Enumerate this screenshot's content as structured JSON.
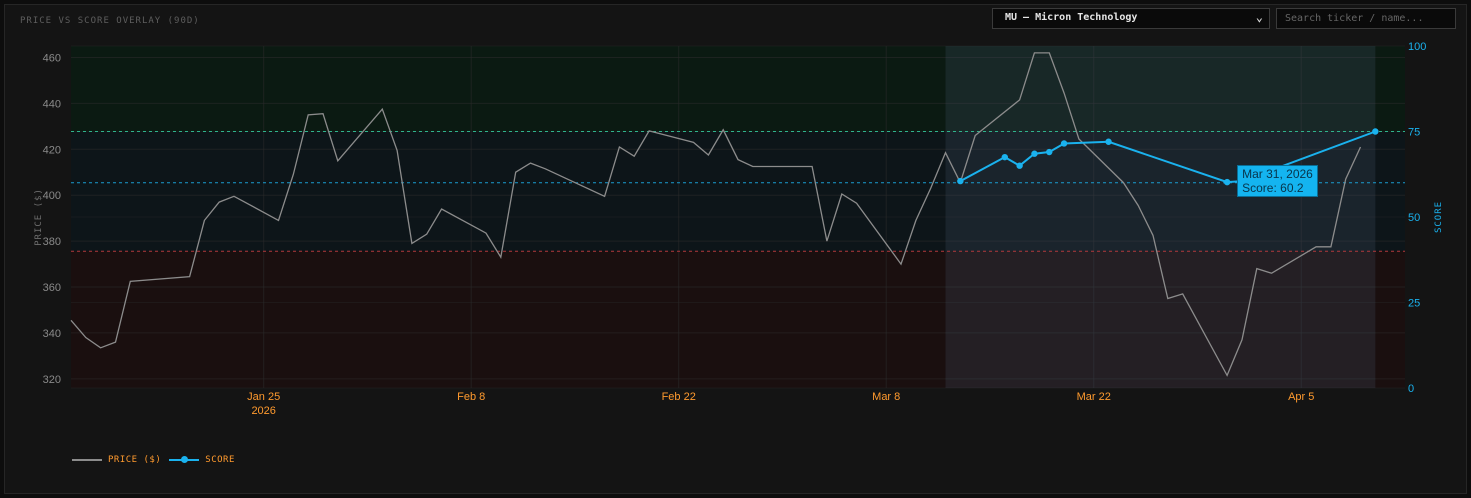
{
  "panel": {
    "title": "PRICE VS SCORE OVERLAY (90D)",
    "ticker_select_value": "MU — Micron Technology",
    "search_placeholder": "Search ticker / name..."
  },
  "tooltip": {
    "date": "Mar 31, 2026",
    "score_text": "Score: 60.2"
  },
  "legend": {
    "price_label": "PRICE ($)",
    "score_label": "SCORE"
  },
  "colors": {
    "price_line": "#8c8c8c",
    "score_line": "#1ab2ee",
    "x_tick_text": "#ff9a2e",
    "left_axis_text": "#8a8a8a",
    "right_axis_text": "#1ab2ee",
    "zone_top": "#0b1a12",
    "zone_mid": "#0d1519",
    "zone_bottom": "#1a0f0f",
    "ref_high": "#2fb38d",
    "ref_mid": "#1a9ccf",
    "ref_low": "#b2393d"
  },
  "chart_data": {
    "type": "line",
    "title": "PRICE VS SCORE OVERLAY (90D)",
    "ylabel": "PRICE ($)",
    "y2label": "SCORE",
    "ylim": [
      316,
      465
    ],
    "y2lim": [
      0,
      100
    ],
    "yticks": [
      320,
      340,
      360,
      380,
      400,
      420,
      440,
      460
    ],
    "y2ticks": [
      0,
      25,
      50,
      75,
      100
    ],
    "xlim": [
      "2026-01-12",
      "2026-04-12"
    ],
    "xticks": [
      {
        "date": "2026-01-25",
        "label": "Jan 25",
        "sublabel": "2026"
      },
      {
        "date": "2026-02-08",
        "label": "Feb 8",
        "sublabel": ""
      },
      {
        "date": "2026-02-22",
        "label": "Feb 22",
        "sublabel": ""
      },
      {
        "date": "2026-03-08",
        "label": "Mar 8",
        "sublabel": ""
      },
      {
        "date": "2026-03-22",
        "label": "Mar 22",
        "sublabel": ""
      },
      {
        "date": "2026-04-05",
        "label": "Apr 5",
        "sublabel": ""
      }
    ],
    "grid": true,
    "legend_position": "bottom-left",
    "reference_lines_score": [
      75,
      60,
      40
    ],
    "zones_score": [
      [
        75,
        100
      ],
      [
        40,
        75
      ],
      [
        0,
        40
      ]
    ],
    "score_highlight_start": "2026-03-12",
    "series": [
      {
        "name": "PRICE ($)",
        "axis": "left",
        "points": [
          [
            "2026-01-12",
            345.5
          ],
          [
            "2026-01-13",
            338
          ],
          [
            "2026-01-14",
            333.5
          ],
          [
            "2026-01-15",
            336
          ],
          [
            "2026-01-16",
            362.5
          ],
          [
            "2026-01-20",
            364.5
          ],
          [
            "2026-01-21",
            389
          ],
          [
            "2026-01-22",
            397
          ],
          [
            "2026-01-23",
            399.5
          ],
          [
            "2026-01-26",
            389
          ],
          [
            "2026-01-27",
            409
          ],
          [
            "2026-01-28",
            435
          ],
          [
            "2026-01-29",
            435.5
          ],
          [
            "2026-01-30",
            415
          ],
          [
            "2026-02-02",
            437.5
          ],
          [
            "2026-02-03",
            419.5
          ],
          [
            "2026-02-04",
            379
          ],
          [
            "2026-02-05",
            383
          ],
          [
            "2026-02-06",
            394
          ],
          [
            "2026-02-09",
            383.5
          ],
          [
            "2026-02-10",
            373
          ],
          [
            "2026-02-11",
            410
          ],
          [
            "2026-02-12",
            414
          ],
          [
            "2026-02-13",
            411.5
          ],
          [
            "2026-02-17",
            399.5
          ],
          [
            "2026-02-18",
            421
          ],
          [
            "2026-02-19",
            417
          ],
          [
            "2026-02-20",
            428
          ],
          [
            "2026-02-23",
            423
          ],
          [
            "2026-02-24",
            417.5
          ],
          [
            "2026-02-25",
            428.5
          ],
          [
            "2026-02-26",
            415.5
          ],
          [
            "2026-02-27",
            412.5
          ],
          [
            "2026-03-02",
            412.5
          ],
          [
            "2026-03-03",
            412.5
          ],
          [
            "2026-03-04",
            380
          ],
          [
            "2026-03-05",
            400.5
          ],
          [
            "2026-03-06",
            396.5
          ],
          [
            "2026-03-09",
            370
          ],
          [
            "2026-03-10",
            389
          ],
          [
            "2026-03-11",
            403
          ],
          [
            "2026-03-12",
            418.5
          ],
          [
            "2026-03-13",
            405.5
          ],
          [
            "2026-03-14",
            426
          ],
          [
            "2026-03-17",
            441.5
          ],
          [
            "2026-03-18",
            462
          ],
          [
            "2026-03-19",
            462
          ],
          [
            "2026-03-20",
            444.5
          ],
          [
            "2026-03-21",
            424.5
          ],
          [
            "2026-03-24",
            405.5
          ],
          [
            "2026-03-25",
            395.5
          ],
          [
            "2026-03-26",
            382.5
          ],
          [
            "2026-03-27",
            355
          ],
          [
            "2026-03-28",
            357
          ],
          [
            "2026-03-31",
            321.5
          ],
          [
            "2026-04-01",
            337
          ],
          [
            "2026-04-02",
            368
          ],
          [
            "2026-04-03",
            366
          ],
          [
            "2026-04-06",
            377.5
          ],
          [
            "2026-04-07",
            377.5
          ],
          [
            "2026-04-08",
            407
          ],
          [
            "2026-04-09",
            421
          ]
        ]
      },
      {
        "name": "SCORE",
        "axis": "right",
        "points": [
          [
            "2026-03-13",
            60.5
          ],
          [
            "2026-03-16",
            67.5
          ],
          [
            "2026-03-17",
            65
          ],
          [
            "2026-03-18",
            68.5
          ],
          [
            "2026-03-19",
            69
          ],
          [
            "2026-03-20",
            71.5
          ],
          [
            "2026-03-23",
            72
          ],
          [
            "2026-03-31",
            60.2
          ],
          [
            "2026-04-01",
            60.5
          ],
          [
            "2026-04-10",
            75
          ]
        ]
      }
    ]
  }
}
